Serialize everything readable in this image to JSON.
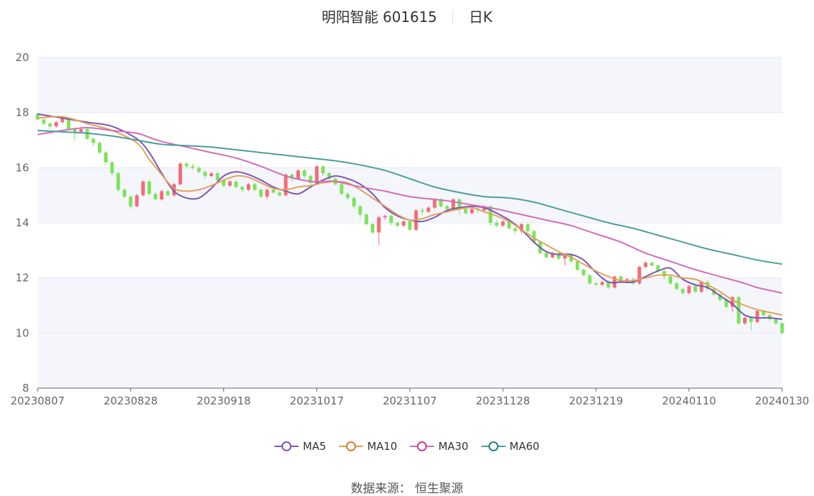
{
  "header": {
    "stock_name": "明阳智能 601615",
    "period": "日K"
  },
  "source": "数据来源：  恒生聚源",
  "colors": {
    "up": "#f46b74",
    "down": "#7de35a",
    "ma5": "#7b55b7",
    "ma10": "#e2a15a",
    "ma30": "#d36cbb",
    "ma60": "#4c9d9d",
    "band": "#f4f6fc"
  },
  "chart_data": {
    "type": "candlestick",
    "ylim": [
      8,
      20
    ],
    "yticks": [
      8,
      10,
      12,
      14,
      16,
      18,
      20
    ],
    "xticks": [
      "20230807",
      "20230828",
      "20230918",
      "20231017",
      "20231107",
      "20231128",
      "20231219",
      "20240110",
      "20240130"
    ],
    "xtick_index": [
      0,
      15,
      30,
      45,
      60,
      75,
      90,
      105,
      120
    ],
    "n": 121,
    "legend": [
      "MA5",
      "MA10",
      "MA30",
      "MA60"
    ],
    "ma": {
      "MA5": [
        [
          0,
          17.95
        ],
        [
          4,
          17.8
        ],
        [
          8,
          17.65
        ],
        [
          12,
          17.5
        ],
        [
          16,
          17.05
        ],
        [
          18,
          16.55
        ],
        [
          20,
          15.8
        ],
        [
          22,
          15.15
        ],
        [
          24,
          14.9
        ],
        [
          26,
          14.9
        ],
        [
          28,
          15.25
        ],
        [
          30,
          15.7
        ],
        [
          32,
          15.85
        ],
        [
          34,
          15.75
        ],
        [
          36,
          15.55
        ],
        [
          38,
          15.3
        ],
        [
          40,
          15.15
        ],
        [
          42,
          15.05
        ],
        [
          44,
          15.3
        ],
        [
          46,
          15.55
        ],
        [
          48,
          15.7
        ],
        [
          50,
          15.6
        ],
        [
          52,
          15.4
        ],
        [
          54,
          15.05
        ],
        [
          56,
          14.55
        ],
        [
          58,
          14.25
        ],
        [
          60,
          14.1
        ],
        [
          62,
          14.05
        ],
        [
          64,
          14.2
        ],
        [
          66,
          14.45
        ],
        [
          68,
          14.55
        ],
        [
          70,
          14.6
        ],
        [
          72,
          14.55
        ],
        [
          74,
          14.35
        ],
        [
          76,
          14.1
        ],
        [
          78,
          13.75
        ],
        [
          80,
          13.3
        ],
        [
          82,
          12.95
        ],
        [
          84,
          12.85
        ],
        [
          86,
          12.85
        ],
        [
          88,
          12.65
        ],
        [
          90,
          12.2
        ],
        [
          92,
          11.85
        ],
        [
          94,
          11.85
        ],
        [
          96,
          11.85
        ],
        [
          98,
          12.05
        ],
        [
          100,
          12.25
        ],
        [
          102,
          12.35
        ],
        [
          104,
          11.95
        ],
        [
          106,
          11.75
        ],
        [
          108,
          11.65
        ],
        [
          110,
          11.35
        ],
        [
          112,
          11.05
        ],
        [
          114,
          10.65
        ],
        [
          116,
          10.55
        ],
        [
          118,
          10.55
        ],
        [
          120,
          10.5
        ]
      ],
      "MA10": [
        [
          0,
          17.8
        ],
        [
          4,
          17.85
        ],
        [
          8,
          17.6
        ],
        [
          12,
          17.35
        ],
        [
          16,
          16.9
        ],
        [
          18,
          16.3
        ],
        [
          20,
          15.75
        ],
        [
          22,
          15.25
        ],
        [
          24,
          15.15
        ],
        [
          26,
          15.2
        ],
        [
          28,
          15.35
        ],
        [
          30,
          15.55
        ],
        [
          32,
          15.7
        ],
        [
          34,
          15.65
        ],
        [
          36,
          15.45
        ],
        [
          38,
          15.25
        ],
        [
          40,
          15.2
        ],
        [
          42,
          15.3
        ],
        [
          44,
          15.35
        ],
        [
          46,
          15.45
        ],
        [
          48,
          15.5
        ],
        [
          50,
          15.45
        ],
        [
          52,
          15.2
        ],
        [
          54,
          14.9
        ],
        [
          56,
          14.6
        ],
        [
          58,
          14.3
        ],
        [
          60,
          14.1
        ],
        [
          62,
          14.15
        ],
        [
          64,
          14.3
        ],
        [
          66,
          14.4
        ],
        [
          68,
          14.5
        ],
        [
          70,
          14.55
        ],
        [
          72,
          14.4
        ],
        [
          74,
          14.25
        ],
        [
          76,
          14.05
        ],
        [
          78,
          13.75
        ],
        [
          80,
          13.45
        ],
        [
          82,
          13.2
        ],
        [
          84,
          12.95
        ],
        [
          86,
          12.75
        ],
        [
          88,
          12.5
        ],
        [
          90,
          12.25
        ],
        [
          92,
          12.05
        ],
        [
          94,
          11.9
        ],
        [
          96,
          11.9
        ],
        [
          98,
          12.0
        ],
        [
          100,
          12.1
        ],
        [
          102,
          12.1
        ],
        [
          104,
          12.0
        ],
        [
          106,
          11.95
        ],
        [
          108,
          11.75
        ],
        [
          110,
          11.5
        ],
        [
          112,
          11.2
        ],
        [
          114,
          11.0
        ],
        [
          116,
          10.85
        ],
        [
          118,
          10.75
        ],
        [
          120,
          10.65
        ]
      ],
      "MA30": [
        [
          0,
          17.2
        ],
        [
          4,
          17.35
        ],
        [
          8,
          17.45
        ],
        [
          12,
          17.35
        ],
        [
          16,
          17.25
        ],
        [
          18,
          17.1
        ],
        [
          20,
          16.95
        ],
        [
          24,
          16.75
        ],
        [
          28,
          16.55
        ],
        [
          32,
          16.35
        ],
        [
          36,
          16.05
        ],
        [
          40,
          15.7
        ],
        [
          44,
          15.5
        ],
        [
          46,
          15.5
        ],
        [
          48,
          15.5
        ],
        [
          52,
          15.3
        ],
        [
          56,
          15.15
        ],
        [
          60,
          14.95
        ],
        [
          64,
          14.85
        ],
        [
          66,
          14.8
        ],
        [
          70,
          14.65
        ],
        [
          74,
          14.5
        ],
        [
          78,
          14.3
        ],
        [
          82,
          14.1
        ],
        [
          86,
          13.9
        ],
        [
          88,
          13.75
        ],
        [
          90,
          13.6
        ],
        [
          94,
          13.3
        ],
        [
          98,
          12.9
        ],
        [
          102,
          12.6
        ],
        [
          106,
          12.3
        ],
        [
          110,
          12.05
        ],
        [
          114,
          11.8
        ],
        [
          116,
          11.65
        ],
        [
          120,
          11.45
        ]
      ],
      "MA60": [
        [
          0,
          17.35
        ],
        [
          4,
          17.3
        ],
        [
          8,
          17.25
        ],
        [
          12,
          17.15
        ],
        [
          16,
          17.0
        ],
        [
          20,
          16.85
        ],
        [
          24,
          16.8
        ],
        [
          28,
          16.75
        ],
        [
          32,
          16.65
        ],
        [
          36,
          16.55
        ],
        [
          40,
          16.45
        ],
        [
          44,
          16.35
        ],
        [
          48,
          16.25
        ],
        [
          52,
          16.1
        ],
        [
          56,
          15.9
        ],
        [
          60,
          15.6
        ],
        [
          64,
          15.3
        ],
        [
          68,
          15.1
        ],
        [
          72,
          14.95
        ],
        [
          76,
          14.9
        ],
        [
          80,
          14.75
        ],
        [
          84,
          14.5
        ],
        [
          88,
          14.25
        ],
        [
          92,
          14.0
        ],
        [
          96,
          13.8
        ],
        [
          100,
          13.55
        ],
        [
          104,
          13.3
        ],
        [
          108,
          13.05
        ],
        [
          112,
          12.85
        ],
        [
          116,
          12.65
        ],
        [
          120,
          12.5
        ]
      ]
    },
    "candles": [
      [
        17.95,
        17.75,
        17.98,
        17.72
      ],
      [
        17.75,
        17.6,
        17.8,
        17.55
      ],
      [
        17.6,
        17.5,
        17.65,
        17.4
      ],
      [
        17.5,
        17.65,
        17.7,
        17.45
      ],
      [
        17.65,
        17.8,
        17.85,
        17.6
      ],
      [
        17.8,
        17.4,
        17.82,
        17.35
      ],
      [
        17.4,
        17.3,
        17.45,
        17.0
      ],
      [
        17.3,
        17.4,
        17.5,
        17.25
      ],
      [
        17.4,
        17.05,
        17.45,
        17.0
      ],
      [
        17.05,
        16.9,
        17.1,
        16.8
      ],
      [
        16.9,
        16.55,
        16.95,
        16.5
      ],
      [
        16.55,
        16.2,
        16.6,
        16.1
      ],
      [
        16.2,
        15.8,
        16.25,
        15.7
      ],
      [
        15.8,
        15.2,
        15.85,
        15.1
      ],
      [
        15.2,
        14.95,
        15.25,
        14.9
      ],
      [
        14.95,
        14.6,
        15.0,
        14.5
      ],
      [
        14.6,
        15.0,
        15.05,
        14.55
      ],
      [
        15.0,
        15.5,
        15.55,
        14.95
      ],
      [
        15.5,
        15.05,
        15.55,
        15.0
      ],
      [
        15.05,
        14.85,
        15.1,
        14.8
      ],
      [
        14.85,
        15.15,
        15.2,
        14.8
      ],
      [
        15.15,
        15.0,
        15.2,
        14.95
      ],
      [
        15.0,
        15.4,
        15.45,
        14.95
      ],
      [
        15.4,
        16.15,
        16.2,
        15.35
      ],
      [
        16.15,
        16.05,
        16.2,
        15.95
      ],
      [
        16.05,
        16.0,
        16.15,
        15.9
      ],
      [
        16.0,
        15.85,
        16.05,
        15.8
      ],
      [
        15.85,
        15.7,
        15.9,
        15.6
      ],
      [
        15.7,
        15.8,
        15.85,
        15.65
      ],
      [
        15.8,
        15.55,
        15.85,
        15.5
      ],
      [
        15.55,
        15.35,
        15.6,
        15.3
      ],
      [
        15.35,
        15.5,
        15.55,
        15.3
      ],
      [
        15.5,
        15.3,
        15.55,
        15.25
      ],
      [
        15.3,
        15.2,
        15.35,
        15.1
      ],
      [
        15.2,
        15.4,
        15.45,
        15.15
      ],
      [
        15.4,
        15.2,
        15.45,
        15.15
      ],
      [
        15.2,
        14.95,
        15.25,
        14.9
      ],
      [
        14.95,
        15.2,
        15.25,
        14.85
      ],
      [
        15.2,
        15.1,
        15.3,
        15.05
      ],
      [
        15.1,
        15.0,
        15.15,
        14.95
      ],
      [
        15.0,
        15.75,
        15.8,
        14.95
      ],
      [
        15.75,
        15.6,
        15.8,
        15.5
      ],
      [
        15.6,
        15.9,
        15.95,
        15.55
      ],
      [
        15.9,
        15.7,
        15.95,
        15.6
      ],
      [
        15.7,
        15.45,
        15.75,
        15.4
      ],
      [
        15.45,
        16.05,
        16.1,
        15.4
      ],
      [
        16.05,
        15.8,
        16.1,
        15.7
      ],
      [
        15.8,
        15.6,
        15.85,
        15.5
      ],
      [
        15.6,
        15.4,
        15.65,
        15.35
      ],
      [
        15.4,
        15.05,
        15.45,
        15.0
      ],
      [
        15.05,
        14.9,
        15.1,
        14.8
      ],
      [
        14.9,
        14.6,
        14.95,
        14.5
      ],
      [
        14.6,
        14.3,
        14.65,
        14.2
      ],
      [
        14.3,
        13.95,
        14.35,
        13.9
      ],
      [
        13.95,
        13.65,
        14.0,
        13.6
      ],
      [
        13.65,
        14.2,
        14.25,
        13.2
      ],
      [
        14.2,
        14.25,
        14.3,
        14.1
      ],
      [
        14.25,
        14.0,
        14.3,
        13.9
      ],
      [
        14.0,
        13.9,
        14.05,
        13.85
      ],
      [
        13.9,
        14.05,
        14.1,
        13.85
      ],
      [
        14.05,
        13.75,
        14.1,
        13.7
      ],
      [
        13.75,
        14.45,
        14.5,
        13.7
      ],
      [
        14.45,
        14.4,
        14.55,
        14.3
      ],
      [
        14.4,
        14.55,
        14.6,
        14.35
      ],
      [
        14.55,
        14.85,
        14.9,
        14.5
      ],
      [
        14.85,
        14.6,
        14.9,
        14.55
      ],
      [
        14.6,
        14.5,
        14.65,
        14.45
      ],
      [
        14.5,
        14.85,
        14.9,
        14.45
      ],
      [
        14.85,
        14.5,
        14.9,
        14.3
      ],
      [
        14.5,
        14.35,
        14.55,
        14.3
      ],
      [
        14.35,
        14.5,
        14.6,
        14.3
      ],
      [
        14.5,
        14.45,
        14.55,
        14.35
      ],
      [
        14.45,
        14.6,
        14.65,
        14.4
      ],
      [
        14.6,
        14.0,
        14.65,
        13.9
      ],
      [
        14.0,
        13.9,
        14.1,
        13.85
      ],
      [
        13.9,
        14.05,
        14.1,
        13.85
      ],
      [
        14.05,
        13.8,
        14.1,
        13.75
      ],
      [
        13.8,
        13.7,
        13.85,
        13.6
      ],
      [
        13.7,
        13.95,
        14.0,
        13.6
      ],
      [
        13.95,
        13.7,
        14.0,
        13.65
      ],
      [
        13.7,
        13.3,
        13.75,
        13.2
      ],
      [
        13.3,
        12.9,
        13.35,
        12.85
      ],
      [
        12.9,
        12.75,
        12.95,
        12.7
      ],
      [
        12.75,
        12.9,
        12.95,
        12.7
      ],
      [
        12.9,
        12.7,
        12.95,
        12.65
      ],
      [
        12.7,
        12.85,
        12.9,
        12.45
      ],
      [
        12.85,
        12.6,
        12.9,
        12.55
      ],
      [
        12.6,
        12.3,
        12.65,
        12.25
      ],
      [
        12.3,
        12.1,
        12.35,
        12.05
      ],
      [
        12.1,
        11.8,
        12.15,
        11.75
      ],
      [
        11.8,
        11.75,
        11.85,
        11.7
      ],
      [
        11.75,
        11.85,
        11.9,
        11.7
      ],
      [
        11.85,
        11.65,
        11.9,
        11.6
      ],
      [
        11.65,
        12.05,
        12.1,
        11.6
      ],
      [
        12.05,
        11.85,
        12.1,
        11.8
      ],
      [
        11.85,
        11.95,
        12.0,
        11.8
      ],
      [
        11.95,
        11.8,
        12.0,
        11.75
      ],
      [
        11.8,
        12.4,
        12.45,
        11.75
      ],
      [
        12.4,
        12.55,
        12.6,
        12.35
      ],
      [
        12.55,
        12.45,
        12.6,
        12.4
      ],
      [
        12.45,
        12.25,
        12.5,
        12.2
      ],
      [
        12.25,
        12.05,
        12.3,
        11.95
      ],
      [
        12.05,
        11.8,
        12.1,
        11.75
      ],
      [
        11.8,
        11.6,
        11.85,
        11.55
      ],
      [
        11.6,
        11.45,
        11.65,
        11.4
      ],
      [
        11.45,
        11.7,
        11.75,
        11.4
      ],
      [
        11.7,
        11.5,
        11.75,
        11.45
      ],
      [
        11.5,
        11.85,
        11.9,
        11.45
      ],
      [
        11.85,
        11.6,
        11.9,
        11.55
      ],
      [
        11.6,
        11.4,
        11.65,
        11.35
      ],
      [
        11.4,
        11.2,
        11.45,
        11.15
      ],
      [
        11.2,
        10.95,
        11.25,
        10.9
      ],
      [
        10.95,
        11.3,
        11.35,
        10.75
      ],
      [
        11.3,
        10.35,
        11.35,
        10.3
      ],
      [
        10.35,
        10.55,
        10.6,
        10.3
      ],
      [
        10.55,
        10.4,
        10.6,
        10.1
      ],
      [
        10.4,
        10.8,
        10.85,
        10.35
      ],
      [
        10.8,
        10.65,
        10.85,
        10.6
      ],
      [
        10.65,
        10.5,
        10.7,
        10.45
      ],
      [
        10.5,
        10.35,
        10.55,
        10.3
      ],
      [
        10.35,
        10.0,
        10.4,
        9.95
      ]
    ]
  }
}
